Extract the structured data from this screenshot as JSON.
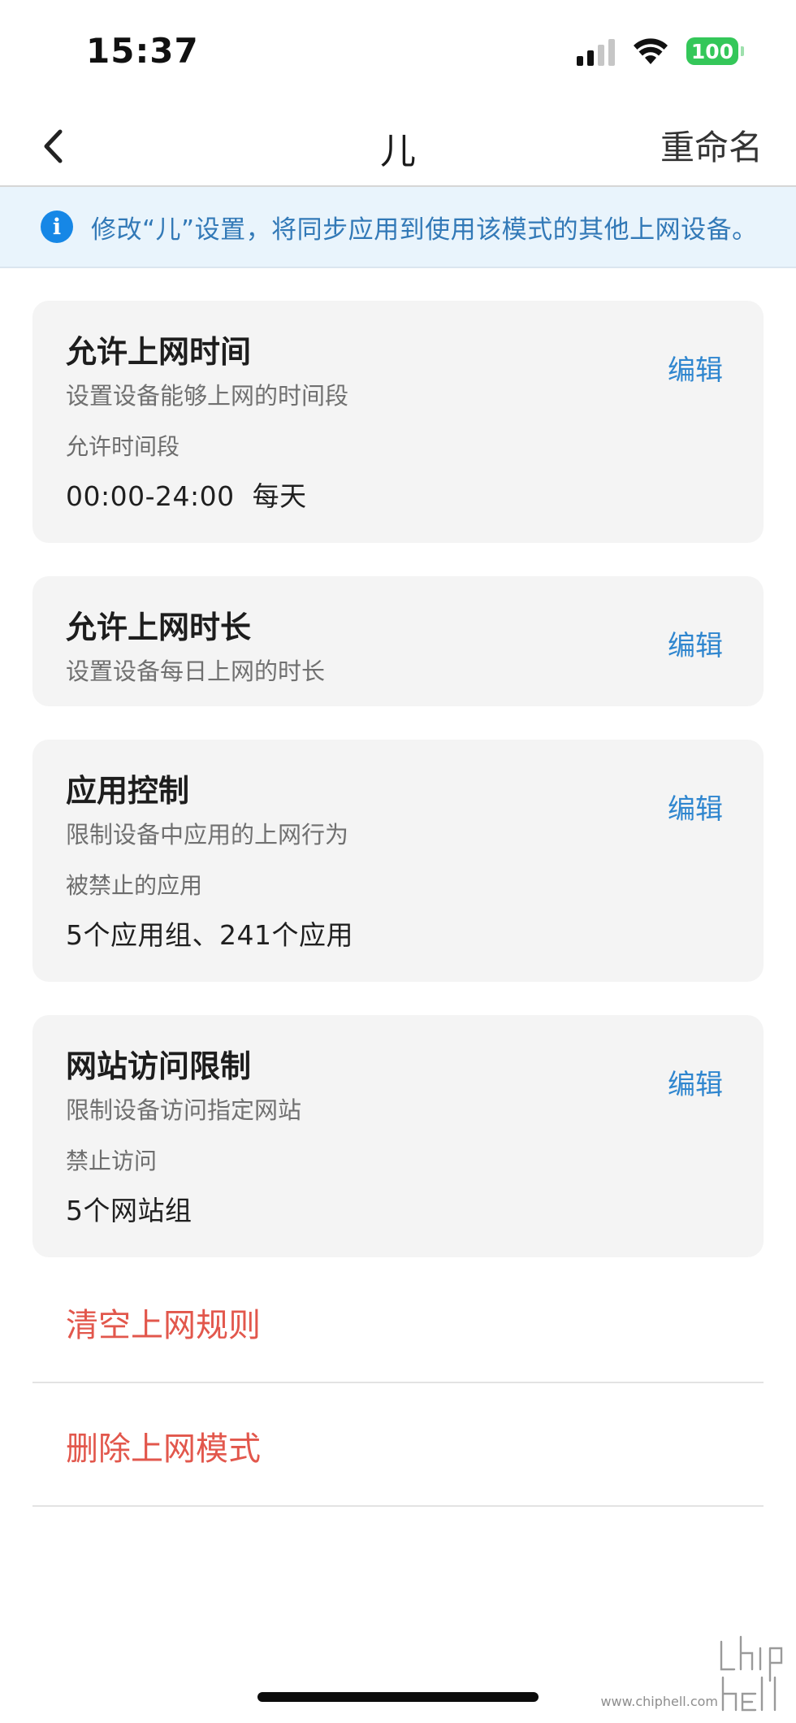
{
  "status_bar": {
    "time": "15:37",
    "battery": "100",
    "signal_icon": "cellular-signal-icon",
    "wifi_icon": "wifi-icon",
    "battery_color": "#34c759"
  },
  "nav": {
    "title": "儿",
    "rename_label": "重命名",
    "back_icon": "chevron-left-icon"
  },
  "banner": {
    "text": "修改“儿”设置，将同步应用到使用该模式的其他上网设备。",
    "icon": "info-icon",
    "color": "#1687e6"
  },
  "cards": [
    {
      "title": "允许上网时间",
      "desc": "设置设备能够上网的时间段",
      "label": "允许时间段",
      "value": "00:00-24:00  每天",
      "edit_label": "编辑"
    },
    {
      "title": "允许上网时长",
      "desc": "设置设备每日上网的时长",
      "edit_label": "编辑"
    },
    {
      "title": "应用控制",
      "desc": "限制设备中应用的上网行为",
      "label": "被禁止的应用",
      "value": "5个应用组、241个应用",
      "edit_label": "编辑"
    },
    {
      "title": "网站访问限制",
      "desc": "限制设备访问指定网站",
      "label": "禁止访问",
      "value": "5个网站组",
      "edit_label": "编辑"
    }
  ],
  "actions": [
    {
      "label": "清空上网规则"
    },
    {
      "label": "删除上网模式"
    }
  ],
  "accent_color": "#2f86cf",
  "danger_color": "#e2574c",
  "watermark": {
    "url": "www.chiphell.com"
  }
}
